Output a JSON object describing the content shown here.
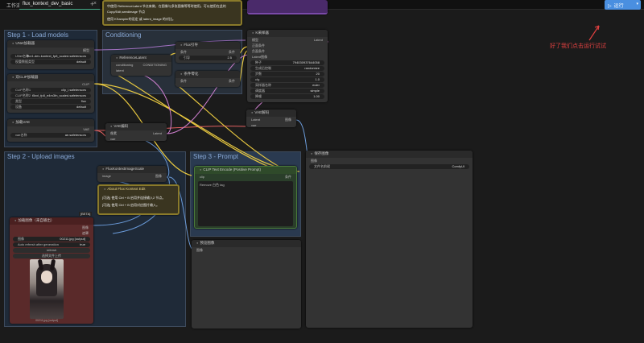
{
  "topbar": {
    "menu_label": "工作流",
    "tab_label": "flux_kontext_dev_basic",
    "close_glyph": "×",
    "plus_glyph": "+",
    "run_label": "运行",
    "run_caret": "▾"
  },
  "annotation": "好了我们点击运行试试",
  "top_note": {
    "line1": "中使用 ReferenceLatent 节点来做，在图像与多张图像等等时使用。可以使用在此的 Copy/Edit,seedimage 节点",
    "line2": "使用 KSampler的设定 或 latent_image 的对比。"
  },
  "groups": {
    "load_models": "Step 1 - Load models",
    "conditioning": "Conditioning",
    "upload_images": "Step 2 - Upload images",
    "prompt": "Step 3 - Prompt"
  },
  "nodes": {
    "unet": {
      "title": "UNet加载器",
      "output": "模型",
      "widgets": [
        {
          "label": "UNet名称",
          "value": "flux1-dev-kontext_fp8_scaled.safetensors"
        },
        {
          "label": "权重数据类型",
          "value": "default"
        }
      ]
    },
    "dualclip": {
      "title": "双CLIP加载器",
      "output": "CLIP",
      "widgets": [
        {
          "label": "CLIP名称1",
          "value": "clip_l.safetensors"
        },
        {
          "label": "CLIP名称2",
          "value": "t5xxl_fp8_e4m3fn_scaled.safetensors"
        },
        {
          "label": "类型",
          "value": "flux"
        },
        {
          "label": "设备",
          "value": "default"
        }
      ]
    },
    "vae_loader": {
      "title": "加载VAE",
      "output": "VAE",
      "widgets": [
        {
          "label": "vae名称",
          "value": "ae.safetensors"
        }
      ]
    },
    "flux_guidance": {
      "title": "Flux引导",
      "input": "条件",
      "output": "条件",
      "widgets": [
        {
          "label": "引导",
          "value": "2.5"
        }
      ]
    },
    "reference_latent": {
      "title": "ReferenceLatent",
      "inputs": [
        "conditioning",
        "latent"
      ],
      "output": "CONDITIONING"
    },
    "cond_zero_out": {
      "title": "条件零化",
      "input": "条件",
      "output": "条件"
    },
    "ksampler": {
      "title": "K采样器",
      "inputs": [
        "模型",
        "正面条件",
        "负面条件",
        "Latent图像"
      ],
      "output": "Latent",
      "widgets": [
        {
          "label": "种子",
          "value": "794030937644058"
        },
        {
          "label": "生成后控制",
          "value": "randomize"
        },
        {
          "label": "步数",
          "value": "20"
        },
        {
          "label": "cfg",
          "value": "1.0"
        },
        {
          "label": "采样器名称",
          "value": "euler"
        },
        {
          "label": "调度器",
          "value": "simple"
        },
        {
          "label": "降噪",
          "value": "1.00"
        }
      ]
    },
    "vae_encode": {
      "title": "VAE编码",
      "inputs": [
        "像素",
        "vae"
      ],
      "output": "Latent"
    },
    "vae_decode": {
      "title": "VAE解码",
      "inputs": [
        "Latent",
        "vae"
      ],
      "output": "图像"
    },
    "save_image": {
      "title": "保存图像",
      "input": "图像",
      "widgets": [
        {
          "label": "文件名前缀",
          "value": "ComfyUI"
        }
      ]
    },
    "flux_scale": {
      "title": "FluxKontextImageScale",
      "input": "image",
      "output": "图像"
    },
    "about_note": {
      "title": "About Flux Kontext Edit",
      "line1": "[可选] 使用 Ctrl + B 启用并连接输入2 节点。",
      "line2": "[可选] 使用 Ctrl + B 启用对应图片输入。"
    },
    "clip_encode": {
      "title": "CLIP Text Encode (Positive Prompt)",
      "input": "clip",
      "output": "条件",
      "text": "Remove 白色 tag"
    },
    "load_image": {
      "title": "加载图像（来自输出）",
      "badge": "[BETA]",
      "outputs": [
        "图像",
        "遮罩"
      ],
      "widgets": [
        {
          "label": "图像",
          "value": "00211.jpg [output]"
        },
        {
          "label": "Auto refresh after generation",
          "value": "true"
        }
      ],
      "refresh": "refresh",
      "upload": "选择文件上传",
      "caption": "00211.jpg [output]"
    },
    "preview": {
      "title": "预览图像",
      "input": "图像"
    }
  },
  "colors": {
    "accent": "#4a8fe0",
    "group_title": "#89a9d6",
    "annotation": "#e04040",
    "wire_yellow": "#e8c840",
    "wire_pink": "#d080d0",
    "wire_blue": "#6a9ad8",
    "wire_red": "#e06060"
  }
}
